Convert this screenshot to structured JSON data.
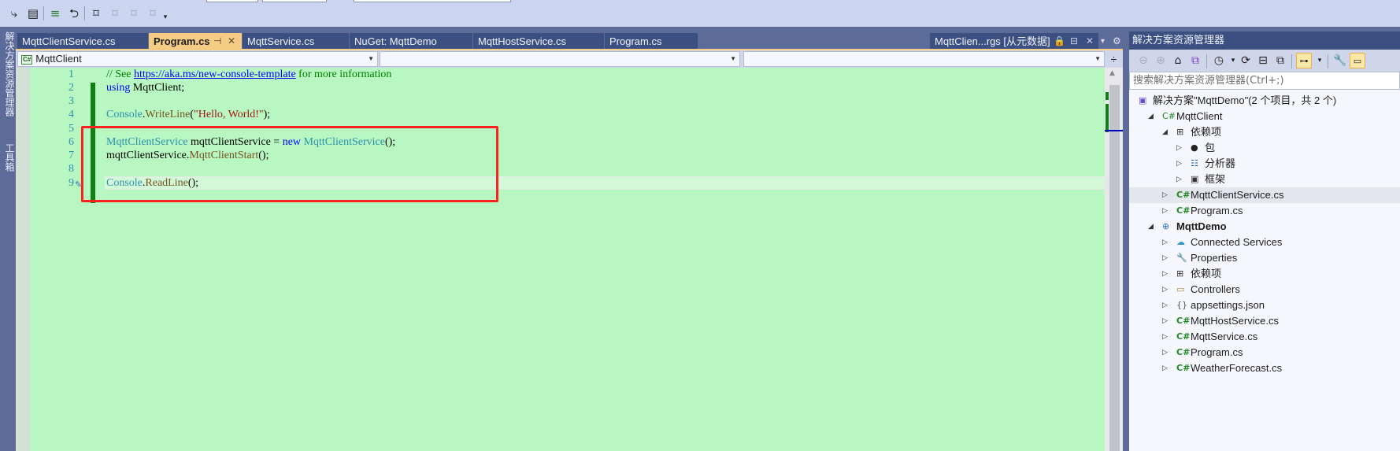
{
  "toolbar": {
    "icons": [
      "step-into-icon",
      "format-document-icon",
      "indent-icon",
      "outdent-icon",
      "bookmark-icon",
      "prev-bookmark-icon",
      "next-bookmark-icon",
      "clear-bookmarks-icon",
      "overflow-icon"
    ]
  },
  "left_strip": {
    "solution_explorer_label": "解决方案资源管理器",
    "toolbox_label": "工具箱"
  },
  "tabs": [
    {
      "label": "MqttClientService.cs",
      "active": false
    },
    {
      "label": "Program.cs",
      "active": true
    },
    {
      "label": "MqttService.cs",
      "active": false
    },
    {
      "label": "NuGet: MqttDemo",
      "active": false
    },
    {
      "label": "MqttHostService.cs",
      "active": false
    },
    {
      "label": "Program.cs",
      "active": false
    }
  ],
  "preview_tab": {
    "label": "MqttClien...rgs [从元数据]"
  },
  "nav": {
    "project_combo": "MqttClient",
    "type_combo": "",
    "member_combo": ""
  },
  "editor": {
    "line_numbers": [
      "1",
      "2",
      "3",
      "4",
      "5",
      "6",
      "7",
      "8",
      "9"
    ],
    "lines": [
      {
        "comment_prefix": "// See ",
        "link": "https://aka.ms/new-console-template",
        "comment_suffix": " for more information"
      },
      {
        "kw": "using",
        "rest": " MqttClient;"
      },
      {},
      {
        "type": "Console",
        "dot": ".",
        "method": "WriteLine",
        "open": "(",
        "str": "\"Hello, World!\"",
        "close": ");"
      },
      {},
      {
        "type": "MqttClientService",
        "var": " mqttClientService = ",
        "kw": "new",
        "type2": " MqttClientService",
        "close": "();"
      },
      {
        "var": "mqttClientService.",
        "method": "MqttClientStart",
        "close": "();"
      },
      {},
      {
        "type": "Console",
        "dot": ".",
        "method": "ReadLine",
        "close": "();"
      }
    ],
    "current_line": 9,
    "highlight_box_color": "#ff2020",
    "background_color": "#b8f7c1"
  },
  "solution_explorer": {
    "title": "解决方案资源管理器",
    "search_placeholder": "搜索解决方案资源管理器(Ctrl+;)",
    "tree": [
      {
        "label": "解决方案\"MqttDemo\"(2 个项目，共 2 个)",
        "icon": "solution-icon",
        "level": 0,
        "expander": ""
      },
      {
        "label": "MqttClient",
        "icon": "csharp-project-icon",
        "level": 1,
        "expander": "◢"
      },
      {
        "label": "依赖项",
        "icon": "dependencies-icon",
        "level": 2,
        "expander": "◢"
      },
      {
        "label": "包",
        "icon": "package-icon",
        "level": 3,
        "expander": "▷"
      },
      {
        "label": "分析器",
        "icon": "analyzer-icon",
        "level": 3,
        "expander": "▷"
      },
      {
        "label": "框架",
        "icon": "framework-icon",
        "level": 3,
        "expander": "▷"
      },
      {
        "label": "MqttClientService.cs",
        "icon": "csharp-file-icon",
        "level": 2,
        "expander": "▷",
        "selected": true
      },
      {
        "label": "Program.cs",
        "icon": "csharp-file-icon",
        "level": 2,
        "expander": "▷"
      },
      {
        "label": "MqttDemo",
        "icon": "web-project-icon",
        "level": 1,
        "expander": "◢",
        "bold": true
      },
      {
        "label": "Connected Services",
        "icon": "connected-services-icon",
        "level": 2,
        "expander": "▷"
      },
      {
        "label": "Properties",
        "icon": "properties-icon",
        "level": 2,
        "expander": "▷"
      },
      {
        "label": "依赖项",
        "icon": "dependencies-icon",
        "level": 2,
        "expander": "▷"
      },
      {
        "label": "Controllers",
        "icon": "folder-icon",
        "level": 2,
        "expander": "▷"
      },
      {
        "label": "appsettings.json",
        "icon": "json-file-icon",
        "level": 2,
        "expander": "▷"
      },
      {
        "label": "MqttHostService.cs",
        "icon": "csharp-file-icon",
        "level": 2,
        "expander": "▷"
      },
      {
        "label": "MqttService.cs",
        "icon": "csharp-file-icon",
        "level": 2,
        "expander": "▷"
      },
      {
        "label": "Program.cs",
        "icon": "csharp-file-icon",
        "level": 2,
        "expander": "▷"
      },
      {
        "label": "WeatherForecast.cs",
        "icon": "csharp-file-icon",
        "level": 2,
        "expander": "▷"
      }
    ]
  }
}
